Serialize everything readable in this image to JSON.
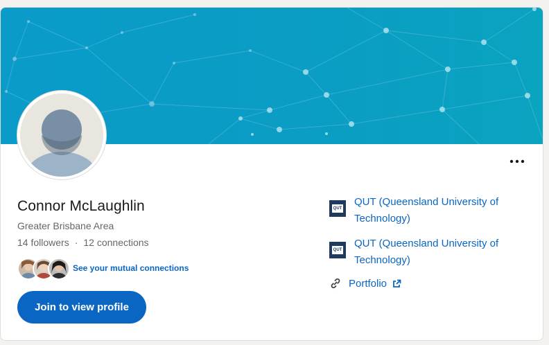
{
  "profile": {
    "name": "Connor McLaughlin",
    "location": "Greater Brisbane Area",
    "followers": "14 followers",
    "separator": "·",
    "connections": "12 connections",
    "mutual_link": "See your mutual connections",
    "join_label": "Join to view profile"
  },
  "education": [
    {
      "name": "QUT (Queensland University of Technology)",
      "logo_text": "QUT"
    },
    {
      "name": "QUT (Queensland University of Technology)",
      "logo_text": "QUT"
    }
  ],
  "portfolio": {
    "label": "Portfolio"
  },
  "icons": {
    "more": "more-options-icon",
    "link": "link-icon",
    "external": "external-link-icon",
    "school": "school-logo-icon"
  },
  "colors": {
    "accent": "#0a66c2",
    "banner": "#0a9bc9",
    "text_primary": "#191919",
    "text_secondary": "#666666"
  }
}
